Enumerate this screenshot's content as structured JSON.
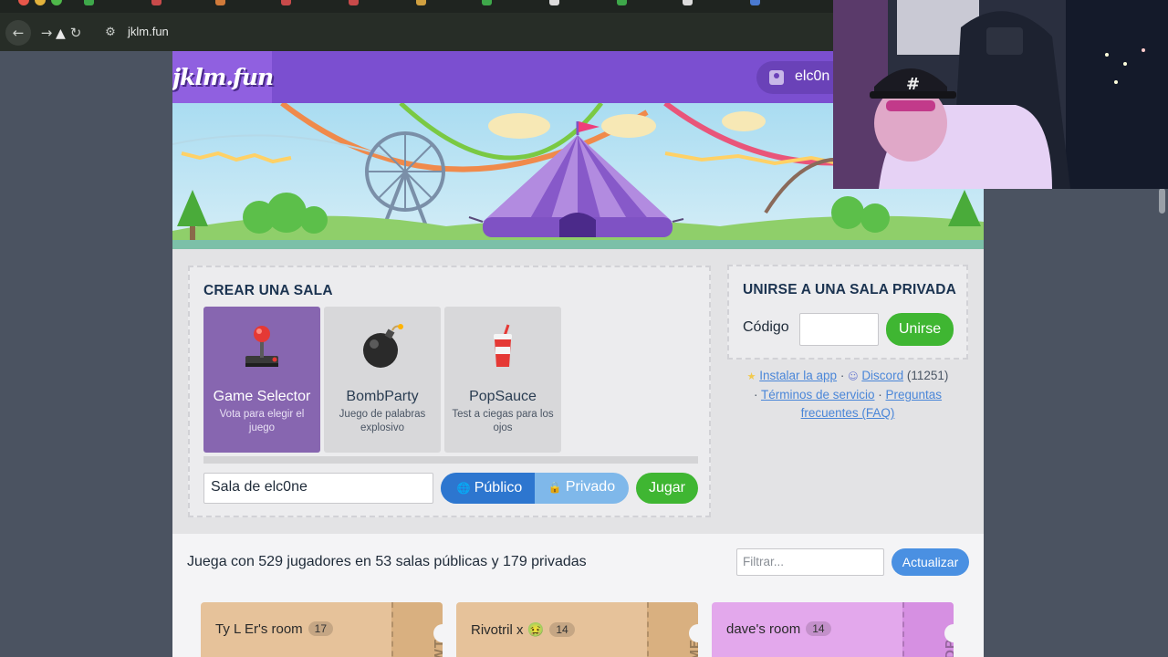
{
  "browser": {
    "url": "jklm.fun",
    "back_glyph": "←",
    "forward_glyph": "→",
    "reload_glyph": "↻",
    "site_settings_glyph": "⚙"
  },
  "site": {
    "logo": "jklm.fun",
    "username": "elc0n"
  },
  "create_room": {
    "title": "CREAR UNA SALA",
    "games": [
      {
        "name": "Game Selector",
        "desc": "Vota para elegir el juego",
        "icon": "joystick-icon",
        "selected": true
      },
      {
        "name": "BombParty",
        "desc": "Juego de palabras explosivo",
        "icon": "bomb-icon",
        "selected": false
      },
      {
        "name": "PopSauce",
        "desc": "Test a ciegas para los ojos",
        "icon": "cup-icon",
        "selected": false
      }
    ],
    "room_name_value": "Sala de elc0ne",
    "public_label": "Público",
    "private_label": "Privado",
    "public_emoji": "🌐",
    "private_emoji": "🔒",
    "play_label": "Jugar"
  },
  "join_private": {
    "title": "UNIRSE A UNA SALA PRIVADA",
    "code_label": "Código",
    "code_value": "",
    "join_label": "Unirse"
  },
  "links": {
    "star": "★",
    "install": "Instalar la app",
    "sep": " · ",
    "discord_icon": "☺",
    "discord": "Discord",
    "discord_count": "(11251)",
    "terms": "Términos de servicio",
    "faq": "Preguntas frecuentes (FAQ)"
  },
  "rooms": {
    "summary": "Juega con 529 jugadores en 53 salas públicas y 179 privadas",
    "filter_placeholder": "Filtrar...",
    "refresh_label": "Actualizar",
    "list": [
      {
        "name": "Ty L Er's room",
        "count": "17",
        "code": "YWT",
        "color": "#e6c29a",
        "stub": "#d9b080"
      },
      {
        "name": "Rivotril x 🤢",
        "count": "14",
        "code": "GME",
        "color": "#e6c29a",
        "stub": "#d9b080"
      },
      {
        "name": "dave's room",
        "count": "14",
        "code": "CDP",
        "color": "#e3a8ec",
        "stub": "#d690e2"
      }
    ]
  },
  "colors": {
    "topbar": "#7b4fd0",
    "green": "#3fb632",
    "blue": "#2d76cf"
  }
}
